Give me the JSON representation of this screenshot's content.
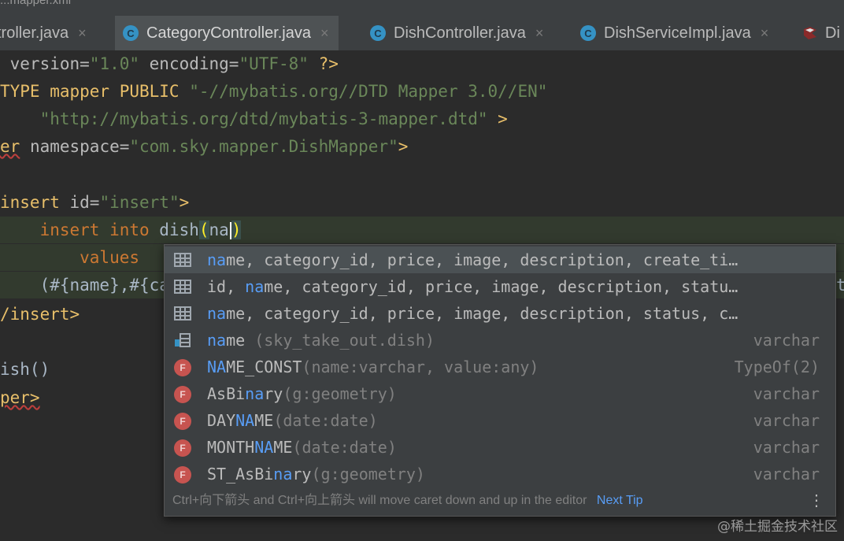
{
  "window": {
    "title": "...mapper.xml"
  },
  "tabs": [
    {
      "label": "troller.java",
      "close": "×"
    },
    {
      "label": "CategoryController.java",
      "close": "×",
      "icon": "C"
    },
    {
      "label": "DishController.java",
      "close": "×",
      "icon": "C"
    },
    {
      "label": "DishServiceImpl.java",
      "close": "×",
      "icon": "C"
    },
    {
      "label": "Di"
    }
  ],
  "code": {
    "l1": {
      "a": " version=",
      "b": "\"1.0\"",
      "c": " encoding=",
      "d": "\"UTF-8\"",
      "e": " ?>"
    },
    "l2": {
      "a": "TYPE mapper PUBLIC ",
      "b": "\"-//mybatis.org//DTD Mapper 3.0//EN\""
    },
    "l3": {
      "a": "    ",
      "b": "\"http://mybatis.org/dtd/mybatis-3-mapper.dtd\"",
      "c": " >"
    },
    "l4": {
      "a": "er",
      "b": " namespace=",
      "c": "\"com.sky.mapper.DishMapper\"",
      "d": ">"
    },
    "l6": {
      "a": "insert",
      "b": " id=",
      "c": "\"insert\"",
      "d": ">"
    },
    "l7": {
      "a": "    insert into ",
      "b": "dish",
      "c": "(",
      "d": "na",
      "e": ")"
    },
    "l8": {
      "a": "        values"
    },
    "l9": {
      "a": "    (#{name},#{ca",
      "b": "t"
    },
    "l10": {
      "a": "/insert>"
    },
    "l12": {
      "a": "ish()"
    },
    "l13": {
      "a": "per>"
    }
  },
  "completion": {
    "items": [
      {
        "hl": "na",
        "rest": "me, category_id, price, image, description, create_ti…",
        "right": "",
        "icon": "table-icon",
        "selected": true
      },
      {
        "pre": "id, ",
        "hl": "na",
        "rest": "me, category_id, price, image, description, statu…",
        "right": "",
        "icon": "table-icon"
      },
      {
        "hl": "na",
        "rest": "me, category_id, price, image, description, status, c…",
        "right": "",
        "icon": "table-icon"
      },
      {
        "hl": "na",
        "rest": "me",
        "dim": " (sky_take_out.dish)",
        "right": "varchar",
        "icon": "column-icon"
      },
      {
        "hl": "NA",
        "rest": "ME_CONST",
        "dim": "(name:varchar, value:any)",
        "right": "TypeOf(2)",
        "icon": "function-icon"
      },
      {
        "pre": "AsBi",
        "hl": "na",
        "rest": "ry",
        "dim": "(g:geometry)",
        "right": "varchar",
        "icon": "function-icon"
      },
      {
        "pre": "DAY",
        "hl": "NA",
        "rest": "ME",
        "dim": "(date:date)",
        "right": "varchar",
        "icon": "function-icon"
      },
      {
        "pre": "MONTH",
        "hl": "NA",
        "rest": "ME",
        "dim": "(date:date)",
        "right": "varchar",
        "icon": "function-icon"
      },
      {
        "pre": "ST_AsBi",
        "hl": "na",
        "rest": "ry",
        "dim": "(g:geometry)",
        "right": "varchar",
        "icon": "function-icon"
      }
    ],
    "function_badge": "F",
    "footer_text": "Ctrl+向下箭头 and Ctrl+向上箭头 will move caret down and up in the editor",
    "next_tip": "Next Tip",
    "menu_glyph": "⋮"
  },
  "watermark": "@稀土掘金技术社区",
  "colors": {
    "keyword": "#cc7832",
    "string": "#6a8759",
    "tag": "#e8bf6a",
    "match_highlight": "#589df6",
    "function_icon": "#c75450"
  }
}
